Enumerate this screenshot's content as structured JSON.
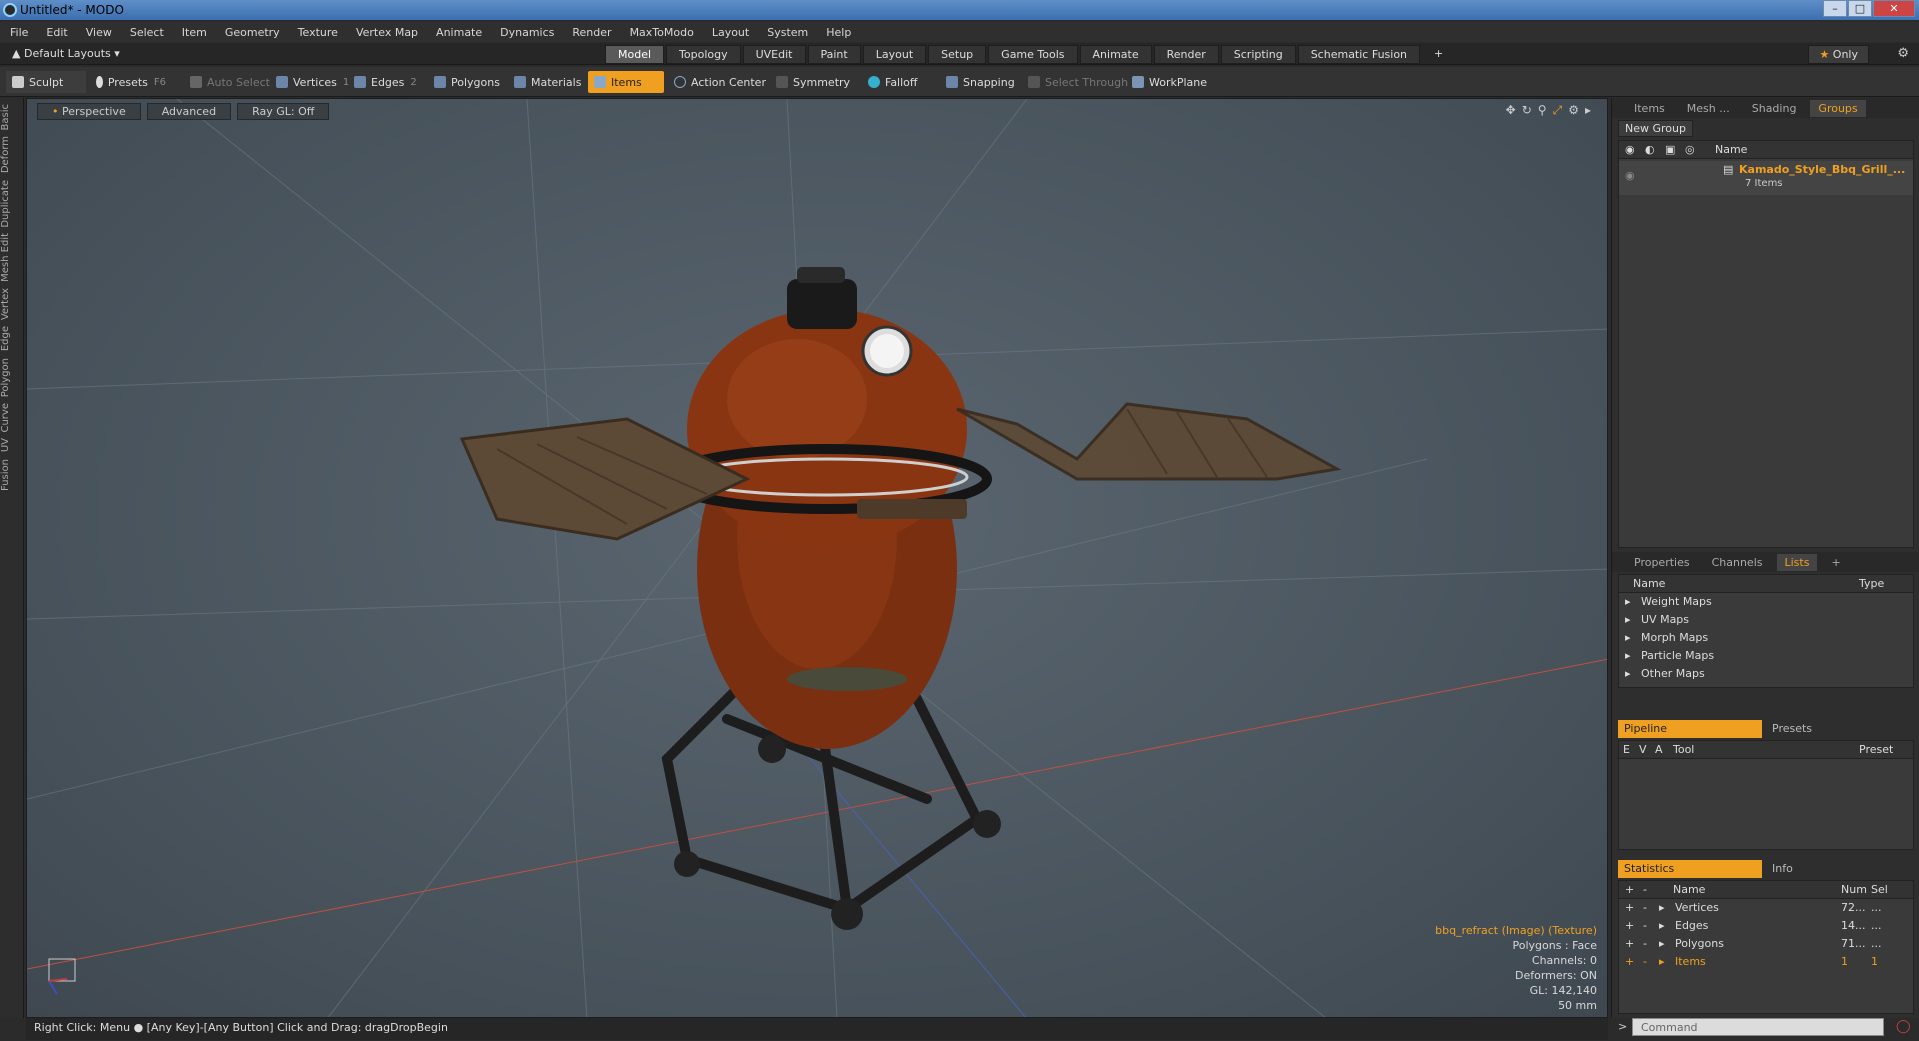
{
  "window": {
    "title": "Untitled* - MODO"
  },
  "menu": [
    "File",
    "Edit",
    "View",
    "Select",
    "Item",
    "Geometry",
    "Texture",
    "Vertex Map",
    "Animate",
    "Dynamics",
    "Render",
    "MaxToModo",
    "Layout",
    "System",
    "Help"
  ],
  "layout_selector": "Default Layouts",
  "mode_tabs": [
    "Model",
    "Topology",
    "UVEdit",
    "Paint",
    "Layout",
    "Setup",
    "Game Tools",
    "Animate",
    "Render",
    "Scripting",
    "Schematic Fusion"
  ],
  "active_mode_tab": "Model",
  "only_label": "Only",
  "toolbar": {
    "sculpt": "Sculpt",
    "presets": "Presets",
    "presets_key": "F6",
    "auto_select": "Auto Select",
    "vertices": "Vertices",
    "vertices_key": "1",
    "edges": "Edges",
    "edges_key": "2",
    "polygons": "Polygons",
    "materials": "Materials",
    "items": "Items",
    "action_center": "Action Center",
    "symmetry": "Symmetry",
    "falloff": "Falloff",
    "snapping": "Snapping",
    "select_through": "Select Through",
    "workplane": "WorkPlane"
  },
  "left_tabs": [
    "Basic",
    "Deform",
    "Duplicate",
    "Mesh Edit",
    "Vertex",
    "Edge",
    "Polygon",
    "Curve",
    "UV",
    "Fusion"
  ],
  "viewport": {
    "view": "Perspective",
    "advanced": "Advanced",
    "raygl": "Ray GL: Off",
    "info": {
      "texture": "bbq_refract (Image) (Texture)",
      "polygons": "Polygons : Face",
      "channels": "Channels: 0",
      "deformers": "Deformers: ON",
      "gl": "GL: 142,140",
      "size": "50 mm"
    }
  },
  "status": "Right Click: Menu ● [Any Key]-[Any Button] Click and Drag: dragDropBegin",
  "groups_panel": {
    "tabs": [
      "Items",
      "Mesh ...",
      "Shading",
      "Groups"
    ],
    "active": "Groups",
    "new_group": "New Group",
    "col_name": "Name",
    "item_name": "Kamado_Style_Bbq_Grill_...",
    "item_count": "7 Items"
  },
  "lists_panel": {
    "tabs": [
      "Properties",
      "Channels",
      "Lists"
    ],
    "active": "Lists",
    "col_name": "Name",
    "col_type": "Type",
    "rows": [
      "Weight Maps",
      "UV Maps",
      "Morph Maps",
      "Particle Maps",
      "Other Maps"
    ]
  },
  "pipeline_panel": {
    "tab_pipeline": "Pipeline",
    "tab_presets": "Presets",
    "cols": [
      "E",
      "V",
      "A",
      "Tool",
      "Preset"
    ]
  },
  "stats_panel": {
    "tab_stats": "Statistics",
    "tab_info": "Info",
    "col_name": "Name",
    "col_num": "Num",
    "col_sel": "Sel",
    "rows": [
      {
        "name": "Vertices",
        "num": "72...",
        "sel": "..."
      },
      {
        "name": "Edges",
        "num": "14...",
        "sel": "..."
      },
      {
        "name": "Polygons",
        "num": "71...",
        "sel": "..."
      },
      {
        "name": "Items",
        "num": "1",
        "sel": "1"
      }
    ]
  },
  "command_placeholder": "Command",
  "colors": {
    "accent": "#f0a020",
    "grill_body": "#8a3a12",
    "viewport_bg": "#4f5a63"
  }
}
